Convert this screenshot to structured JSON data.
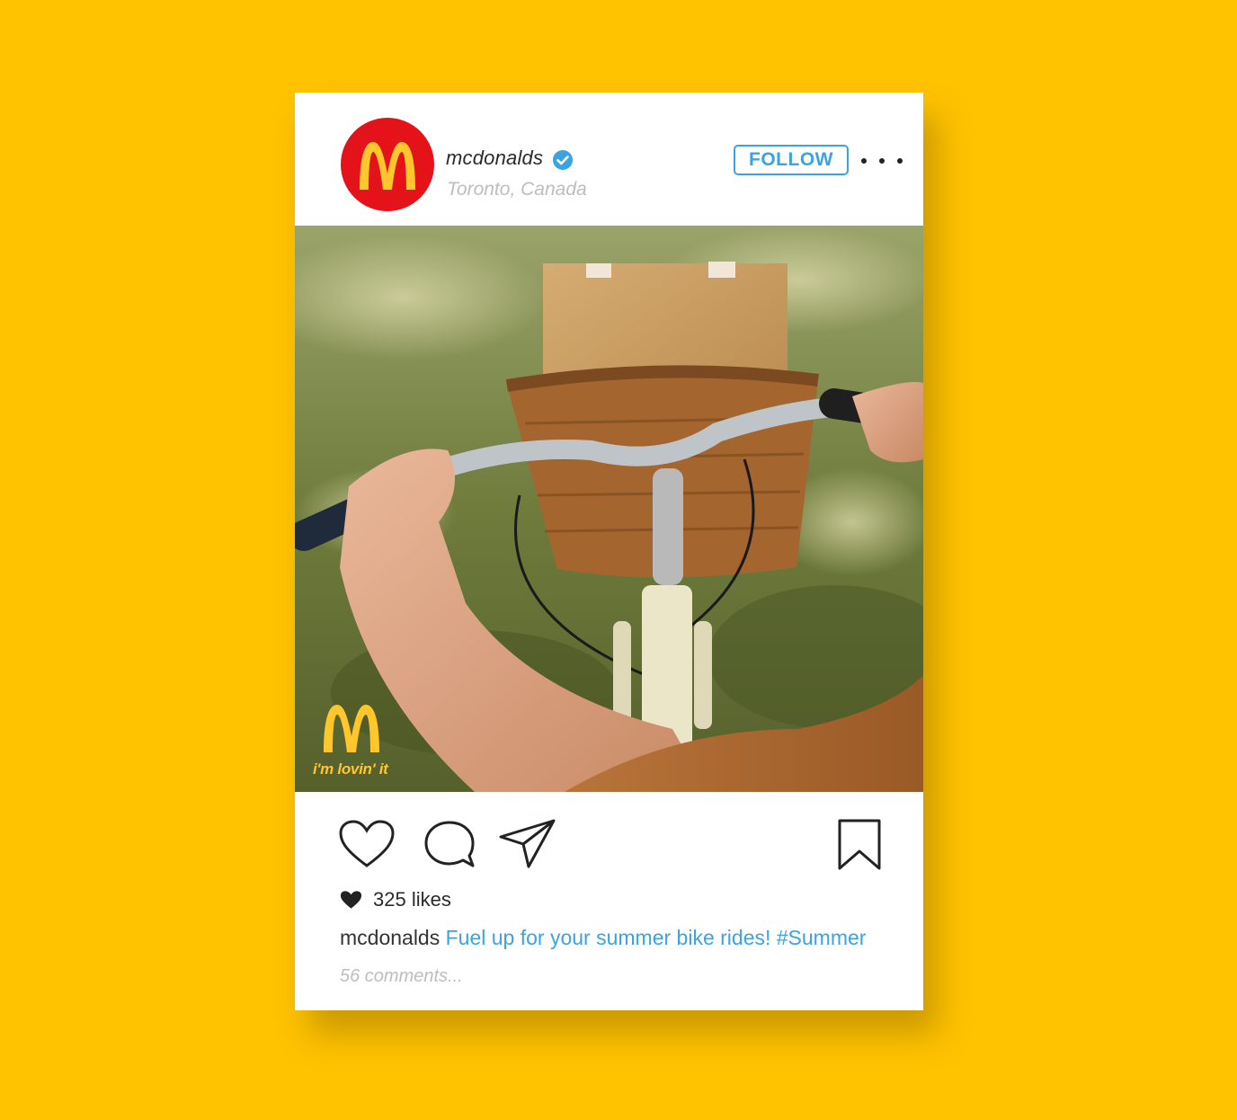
{
  "post": {
    "username": "mcdonalds",
    "verified": true,
    "location": "Toronto, Canada",
    "follow_label": "FOLLOW",
    "avatar_logo": "mcdonalds-golden-arches",
    "more_icon": "ellipsis-icon",
    "image": {
      "description_icon": "photo",
      "watermark_tagline": "i'm lovin' it"
    },
    "actions": {
      "like_icon": "heart-outline-icon",
      "comment_icon": "speech-bubble-icon",
      "share_icon": "paper-plane-icon",
      "save_icon": "bookmark-icon"
    },
    "likes_text": "325 likes",
    "caption": {
      "user": "mcdonalds",
      "text": "Fuel up for your summer bike rides! #Summer"
    },
    "comments_text": "56 comments..."
  },
  "colors": {
    "background": "#FFC300",
    "avatar_red": "#E4131A",
    "arches_yellow": "#FFC72C",
    "accent_blue": "#3aa3e0",
    "muted_gray": "#bdbdbd"
  }
}
